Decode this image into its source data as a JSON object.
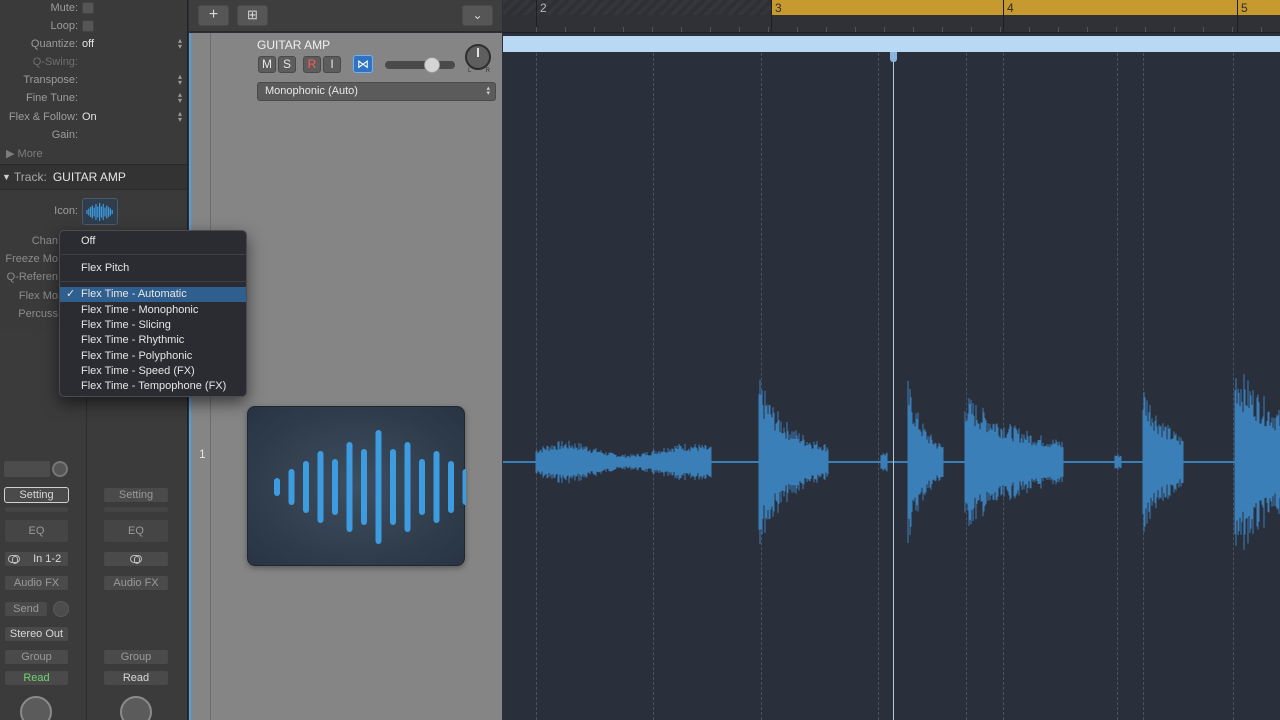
{
  "inspector": {
    "rows": [
      {
        "label": "Mute:",
        "value": "",
        "type": "check"
      },
      {
        "label": "Loop:",
        "value": "",
        "type": "check"
      },
      {
        "label": "Quantize:",
        "value": "off",
        "type": "popup"
      },
      {
        "label": "Q-Swing:",
        "value": "",
        "type": "dim"
      },
      {
        "label": "Transpose:",
        "value": "",
        "type": "popup"
      },
      {
        "label": "Fine Tune:",
        "value": "",
        "type": "popup"
      },
      {
        "label": "Flex & Follow:",
        "value": "On",
        "type": "popup"
      },
      {
        "label": "Gain:",
        "value": "",
        "type": "plain"
      }
    ],
    "more_label": "More",
    "track_label": "Track:",
    "track_name": "GUITAR AMP",
    "icon_label": "Icon:",
    "cut_labels": [
      "Chan",
      "Freeze Mo",
      "Q-Referen",
      "Flex Mo",
      "Percuss"
    ]
  },
  "strip_left": {
    "setting": "Setting",
    "eq": "EQ",
    "input": "In 1-2",
    "audio_fx": "Audio FX",
    "send": "Send",
    "output": "Stereo Out",
    "group": "Group",
    "automation": "Read"
  },
  "strip_right": {
    "setting": "Setting",
    "eq": "EQ",
    "audio_fx": "Audio FX",
    "group": "Group",
    "automation": "Read"
  },
  "toolbar": {
    "add_label": "+",
    "duplicate_label": "⊞",
    "collapse_label": "⌄"
  },
  "track": {
    "number": "1",
    "name": "GUITAR AMP",
    "mute": "M",
    "solo": "S",
    "record": "R",
    "input_monitor": "I",
    "flex_glyph": "⋈",
    "pan_l": "L",
    "pan_r": "R",
    "flex_mode": "Monophonic (Auto)",
    "volume_fraction": 0.72
  },
  "ruler": {
    "bars": [
      "2",
      "3",
      "4",
      "5"
    ]
  },
  "flex_menu": {
    "items": [
      {
        "label": "Off",
        "selected": false
      },
      {
        "label": "Flex Pitch",
        "selected": false
      },
      {
        "label": "Flex Time - Automatic",
        "selected": true
      },
      {
        "label": "Flex Time - Monophonic",
        "selected": false
      },
      {
        "label": "Flex Time - Slicing",
        "selected": false
      },
      {
        "label": "Flex Time - Rhythmic",
        "selected": false
      },
      {
        "label": "Flex Time - Polyphonic",
        "selected": false
      },
      {
        "label": "Flex Time - Speed (FX)",
        "selected": false
      },
      {
        "label": "Flex Time - Tempophone (FX)",
        "selected": false
      }
    ],
    "check_glyph": "✓"
  },
  "colors": {
    "waveform": "#3a7fb8",
    "region": "#b9d8f3",
    "cycle": "#c79a2f",
    "menu_highlight": "#2f5f8f",
    "flex_button": "#2f73c2",
    "icon_bars": "#3d9be0"
  }
}
